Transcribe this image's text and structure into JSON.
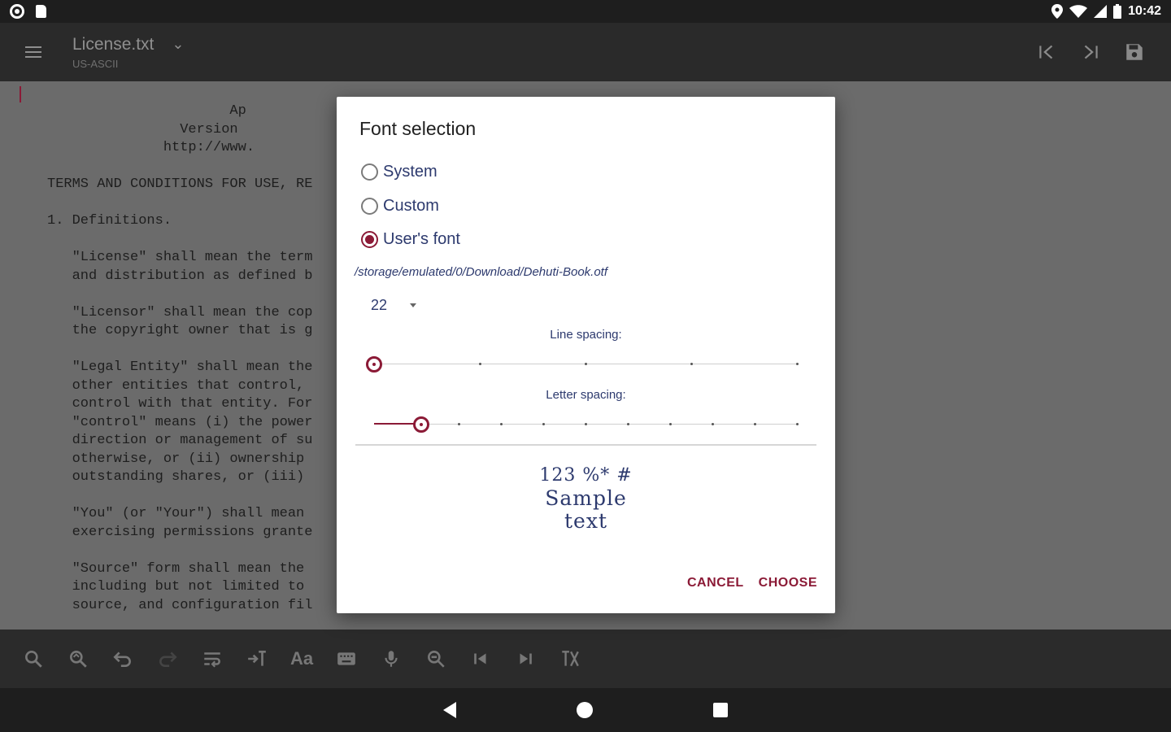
{
  "status_bar": {
    "time": "10:42",
    "icons": [
      "settings-icon",
      "sd-card-icon",
      "location-icon",
      "wifi-icon",
      "signal-icon",
      "battery-icon"
    ]
  },
  "app_bar": {
    "file_name": "License.txt",
    "encoding": "US-ASCII",
    "icons": [
      "menu-icon",
      "chevron-down-icon",
      "jump-start-icon",
      "jump-end-icon",
      "save-icon"
    ]
  },
  "editor": {
    "lines": [
      "                      Ap",
      "                Version",
      "              http://www.",
      "",
      "TERMS AND CONDITIONS FOR USE, RE",
      "",
      "1. Definitions.",
      "",
      "   \"License\" shall mean the term",
      "   and distribution as defined b",
      "",
      "   \"Licensor\" shall mean the cop",
      "   the copyright owner that is g",
      "",
      "   \"Legal Entity\" shall mean the",
      "   other entities that control, ",
      "   control with that entity. For",
      "   \"control\" means (i) the power",
      "   direction or management of su",
      "   otherwise, or (ii) ownership ",
      "   outstanding shares, or (iii) ",
      "",
      "   \"You\" (or \"Your\") shall mean ",
      "   exercising permissions grante",
      "",
      "   \"Source\" form shall mean the ",
      "   including but not limited to ",
      "   source, and configuration fil"
    ]
  },
  "toolbar": {
    "icons": [
      "search-icon",
      "search-replace-icon",
      "undo-icon",
      "redo-icon",
      "wrap-icon",
      "indent-icon",
      "font-icon",
      "keyboard-icon",
      "microphone-icon",
      "zoom-icon",
      "jump-start-icon",
      "jump-end-icon",
      "case-icon"
    ],
    "font_label": "Aa"
  },
  "dialog": {
    "title": "Font selection",
    "options": [
      {
        "label": "System",
        "checked": false
      },
      {
        "label": "Custom",
        "checked": false
      },
      {
        "label": "User's font",
        "checked": true
      }
    ],
    "font_path": "/storage/emulated/0/Download/Dehuti-Book.otf",
    "font_size": "22",
    "line_spacing": {
      "label": "Line spacing:",
      "value_fraction": 0.0,
      "ticks": 4
    },
    "letter_spacing": {
      "label": "Letter spacing:",
      "value_fraction": 0.111,
      "ticks": 10
    },
    "sample_line1": "123 %* #",
    "sample_line2": "Sample",
    "sample_line3": "text",
    "cancel_label": "CANCEL",
    "choose_label": "CHOOSE"
  },
  "colors": {
    "accent": "#8b1a36",
    "text_blue": "#2d3a6e",
    "editor_bg": "#6b6b6b"
  }
}
